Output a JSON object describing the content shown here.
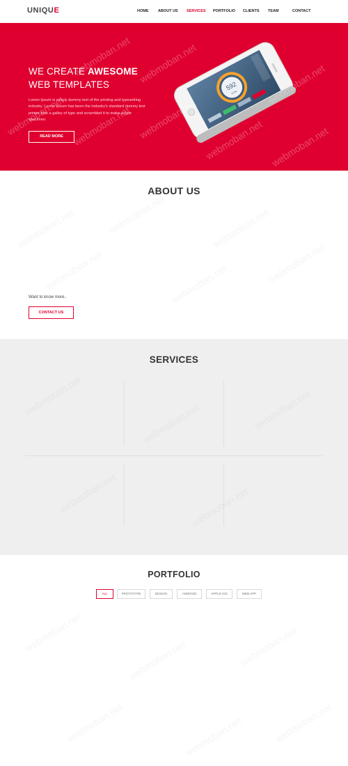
{
  "brand": {
    "logo_main": "UNIQU",
    "logo_end": "E"
  },
  "nav": {
    "items": [
      {
        "label": "HOME"
      },
      {
        "label": "ABOUT US"
      },
      {
        "label": "SERVICES"
      },
      {
        "label": "PORTFOLIO"
      },
      {
        "label": "CLIENTS"
      },
      {
        "label": "TEAM"
      },
      {
        "label": "CONTACT"
      }
    ],
    "active": "SERVICES"
  },
  "hero": {
    "title_line1_prefix": "WE CREATE ",
    "title_line1_bold": "AWESOME",
    "title_line2": "WEB TEMPLATES",
    "text": "Lorem Ipsum is simply dummy text of the printing and typesetting industry. Lorem Ipsum has been the industry's standard dummy text printer took a galley of type and scrambled it to make a type specimen.",
    "button": "READ MORE",
    "phone_stat_value": "592",
    "phone_stat_sub": "KCAL"
  },
  "about": {
    "title": "ABOUT US",
    "text": "Want to know more..",
    "button": "CONTACT US"
  },
  "services": {
    "title": "SERVICES"
  },
  "portfolio": {
    "title": "PORTFOLIO",
    "filters": [
      {
        "label": "ALL"
      },
      {
        "label": "PROTOTYPE"
      },
      {
        "label": "DESIGN"
      },
      {
        "label": "ANDROID"
      },
      {
        "label": "APPLE IOS"
      },
      {
        "label": "WEB APP"
      }
    ],
    "active_filter": "ALL"
  },
  "watermark": "webmoban.net",
  "colors": {
    "accent": "#e0002f",
    "services_bg": "#efefef"
  }
}
